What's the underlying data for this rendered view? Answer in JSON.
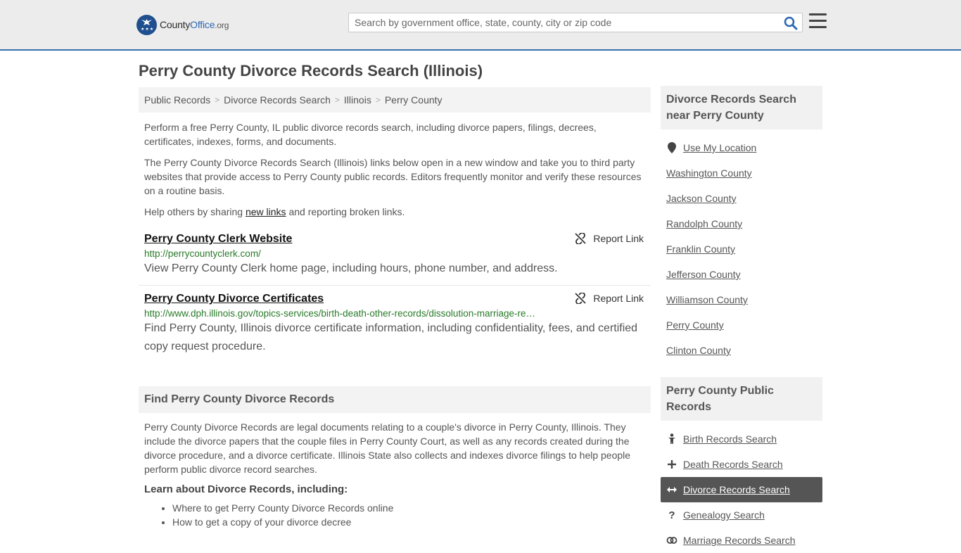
{
  "header": {
    "logo_county": "County",
    "logo_office": "Office",
    "logo_org": ".org",
    "search_placeholder": "Search by government office, state, county, city or zip code"
  },
  "page_title": "Perry County Divorce Records Search (Illinois)",
  "breadcrumb": [
    "Public Records",
    "Divorce Records Search",
    "Illinois",
    "Perry County"
  ],
  "intro": {
    "p1": "Perform a free Perry County, IL public divorce records search, including divorce papers, filings, decrees, certificates, indexes, forms, and documents.",
    "p2": "The Perry County Divorce Records Search (Illinois) links below open in a new window and take you to third party websites that provide access to Perry County public records. Editors frequently monitor and verify these resources on a routine basis.",
    "p3_before": "Help others by sharing ",
    "p3_link": "new links",
    "p3_after": " and reporting broken links."
  },
  "results": [
    {
      "title": "Perry County Clerk Website",
      "url": "http://perrycountyclerk.com/",
      "desc": "View Perry County Clerk home page, including hours, phone number, and address.",
      "report": "Report Link"
    },
    {
      "title": "Perry County Divorce Certificates",
      "url": "http://www.dph.illinois.gov/topics-services/birth-death-other-records/dissolution-marriage-re…",
      "desc": "Find Perry County, Illinois divorce certificate information, including confidentiality, fees, and certified copy request procedure.",
      "report": "Report Link"
    }
  ],
  "find_section": {
    "heading": "Find Perry County Divorce Records",
    "body": "Perry County Divorce Records are legal documents relating to a couple's divorce in Perry County, Illinois. They include the divorce papers that the couple files in Perry County Court, as well as any records created during the divorce procedure, and a divorce certificate. Illinois State also collects and indexes divorce filings to help people perform public divorce record searches.",
    "learn_heading": "Learn about Divorce Records, including:",
    "items": [
      "Where to get Perry County Divorce Records online",
      "How to get a copy of your divorce decree"
    ]
  },
  "sidebar_nearby": {
    "heading": "Divorce Records Search near Perry County",
    "use_location": "Use My Location",
    "counties": [
      "Washington County",
      "Jackson County",
      "Randolph County",
      "Franklin County",
      "Jefferson County",
      "Williamson County",
      "Perry County",
      "Clinton County"
    ]
  },
  "sidebar_public": {
    "heading": "Perry County Public Records",
    "items": [
      {
        "label": "Birth Records Search",
        "icon": "child-icon"
      },
      {
        "label": "Death Records Search",
        "icon": "cross-icon"
      },
      {
        "label": "Divorce Records Search",
        "icon": "arrows-horizontal-icon",
        "active": true
      },
      {
        "label": "Genealogy Search",
        "icon": "question-icon"
      },
      {
        "label": "Marriage Records Search",
        "icon": "rings-icon"
      }
    ]
  }
}
